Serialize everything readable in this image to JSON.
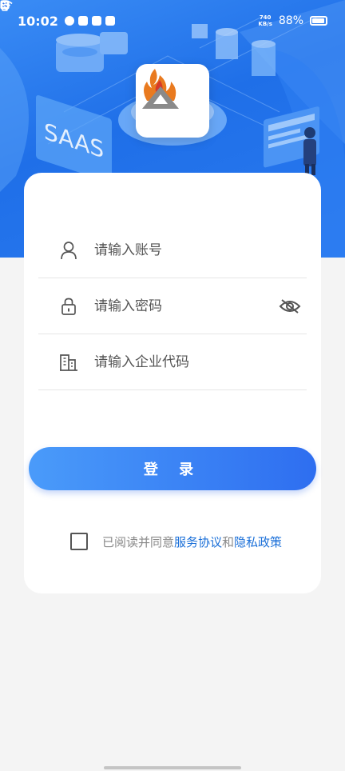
{
  "status_bar": {
    "time": "10:02",
    "net_speed_value": "740",
    "net_speed_unit": "KB/s",
    "battery": "88%"
  },
  "login": {
    "account_placeholder": "请输入账号",
    "password_placeholder": "请输入密码",
    "company_placeholder": "请输入企业代码",
    "login_button": "登 录",
    "agree_prefix": "已阅读并同意",
    "service_agreement": "服务协议",
    "and": "和",
    "privacy_policy": "隐私政策"
  },
  "hero": {
    "saas_text": "SAAS"
  },
  "colors": {
    "primary": "#2e6ef0",
    "link": "#1a6fd8"
  }
}
